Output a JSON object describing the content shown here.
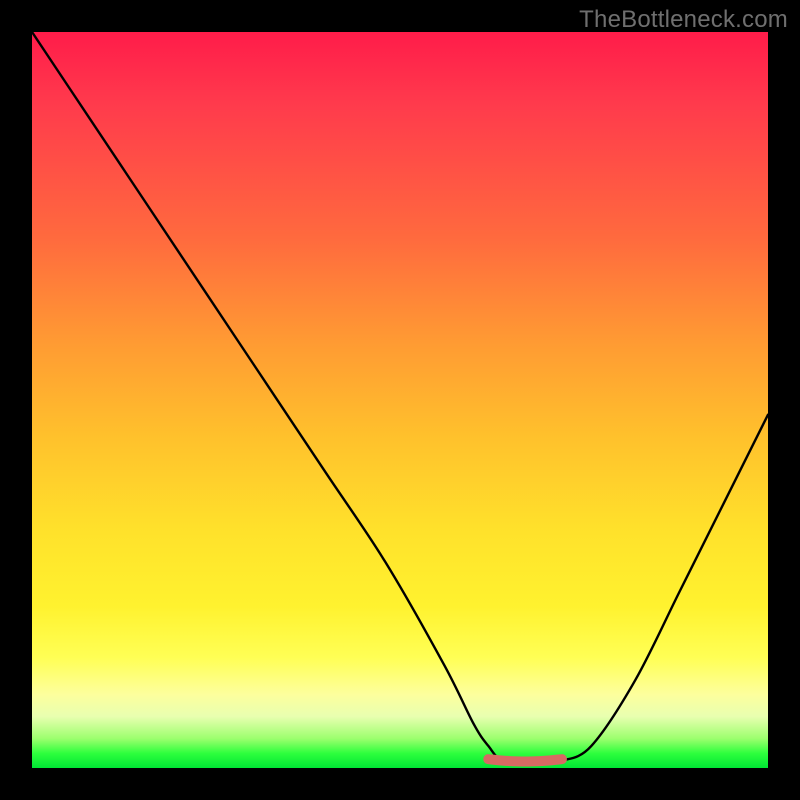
{
  "watermark": "TheBottleneck.com",
  "chart_data": {
    "type": "line",
    "title": "",
    "xlabel": "",
    "ylabel": "",
    "xlim": [
      0,
      100
    ],
    "ylim": [
      0,
      100
    ],
    "grid": false,
    "series": [
      {
        "name": "curve",
        "x": [
          0,
          8,
          16,
          24,
          32,
          40,
          48,
          56,
          60,
          62,
          64,
          68,
          70,
          72,
          76,
          82,
          88,
          94,
          100
        ],
        "values": [
          100,
          88,
          76,
          64,
          52,
          40,
          28,
          14,
          6,
          3,
          1,
          1,
          1,
          1,
          3,
          12,
          24,
          36,
          48
        ]
      },
      {
        "name": "flat-highlight",
        "x": [
          62,
          64,
          66,
          68,
          70,
          72
        ],
        "values": [
          1.2,
          1.0,
          0.9,
          0.9,
          1.0,
          1.2
        ]
      }
    ],
    "annotations": [],
    "colors": {
      "curve": "#000000",
      "highlight": "#d76a63",
      "gradient_top": "#ff1c4a",
      "gradient_bottom": "#00e534"
    }
  }
}
